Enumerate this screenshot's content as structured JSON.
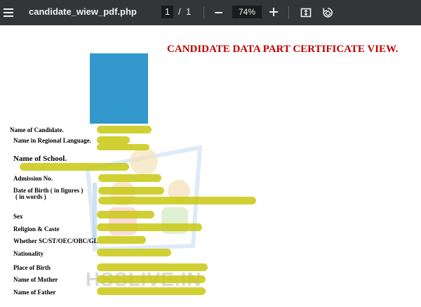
{
  "toolbar": {
    "title": "candidate_wiew_pdf.php",
    "current_page": "1",
    "page_separator": "/",
    "total_pages": "1",
    "zoom": "74%"
  },
  "document": {
    "heading": "CANDIDATE DATA PART CERTIFICATE VIEW.",
    "fields": {
      "name_of_candidate": "Name of Candidate.",
      "name_regional": "Name in Regional Language.",
      "name_of_school": "Name of School.",
      "admission_no": "Admission No.",
      "dob_figures": "Date of Birth ( in figures )",
      "dob_words": "( in words )",
      "sex": "Sex",
      "religion_caste": "Religion & Caste",
      "category": "Whether SC/ST/OEC/OBC/GL",
      "nationality": "Nationality",
      "place_of_birth": "Place of Birth",
      "name_of_mother": "Name of Mother",
      "name_of_father": "Name of Father"
    },
    "watermark_text": "HSSLIVE.IN",
    "photo_color": "#3399cc",
    "highlight_color": "#c8c812",
    "heading_color": "#c00000"
  }
}
